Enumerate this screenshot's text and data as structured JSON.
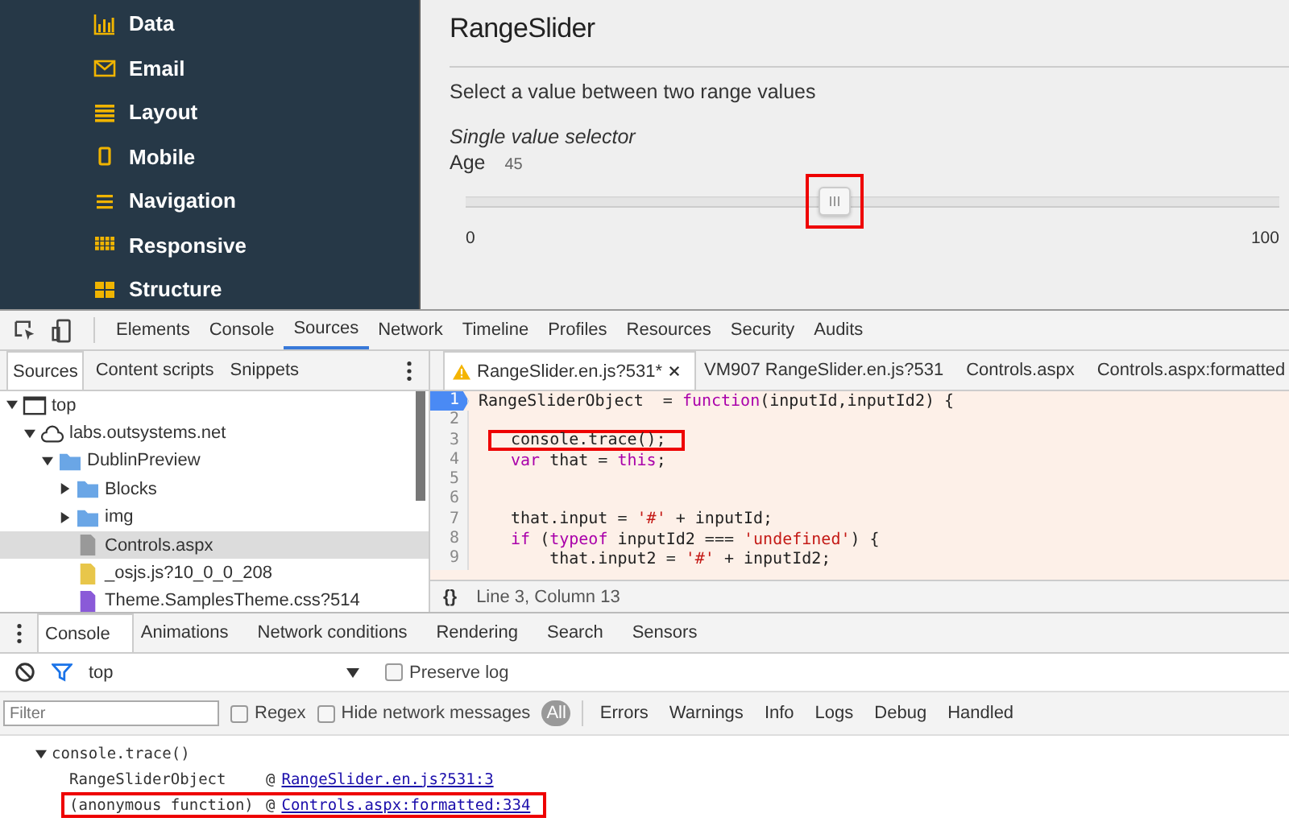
{
  "sidebar": {
    "items": [
      {
        "label": "Data",
        "kind": "chart"
      },
      {
        "label": "Email",
        "kind": "envelope"
      },
      {
        "label": "Layout",
        "kind": "lines"
      },
      {
        "label": "Mobile",
        "kind": "phone"
      },
      {
        "label": "Navigation",
        "kind": "menu"
      },
      {
        "label": "Responsive",
        "kind": "table"
      },
      {
        "label": "Structure",
        "kind": "blocks"
      }
    ]
  },
  "page": {
    "title": "RangeSlider",
    "description": "Select a value between two range values",
    "section": "Single value selector",
    "slider": {
      "label": "Age",
      "value": "45",
      "level": 0.45,
      "min": "0",
      "max": "100",
      "annotated": true
    }
  },
  "devtools": {
    "tabs": [
      {
        "label": "Elements",
        "selected": false
      },
      {
        "label": "Console",
        "selected": false
      },
      {
        "label": "Sources",
        "selected": true
      },
      {
        "label": "Network",
        "selected": false
      },
      {
        "label": "Timeline",
        "selected": false
      },
      {
        "label": "Profiles",
        "selected": false
      },
      {
        "label": "Resources",
        "selected": false
      },
      {
        "label": "Security",
        "selected": false
      },
      {
        "label": "Audits",
        "selected": false
      }
    ],
    "navigator": {
      "tabs": [
        {
          "label": "Sources",
          "selected": true
        },
        {
          "label": "Content scripts",
          "selected": false
        },
        {
          "label": "Snippets",
          "selected": false
        }
      ],
      "tree": [
        {
          "label": "top",
          "kind": "frame",
          "expanded": true,
          "selected": false,
          "children": [
            {
              "label": "labs.outsystems.net",
              "kind": "domain",
              "expanded": true,
              "selected": false,
              "children": [
                {
                  "label": "DublinPreview",
                  "kind": "folder",
                  "expanded": true,
                  "selected": false,
                  "children": [
                    {
                      "label": "Blocks",
                      "kind": "folder",
                      "expanded": false,
                      "selected": false
                    },
                    {
                      "label": "img",
                      "kind": "folder",
                      "expanded": false,
                      "selected": false
                    },
                    {
                      "label": "Controls.aspx",
                      "kind": "document",
                      "selected": true
                    },
                    {
                      "label": "_osjs.js?10_0_0_208",
                      "kind": "script",
                      "selected": false
                    },
                    {
                      "label": "Theme.SamplesTheme.css?514",
                      "kind": "stylesheet",
                      "selected": false
                    }
                  ]
                }
              ]
            }
          ]
        }
      ]
    },
    "editor": {
      "tabs": [
        {
          "label": "RangeSlider.en.js?531*",
          "warning": true,
          "selected": true
        },
        {
          "label": "VM907 RangeSlider.en.js?531",
          "warning": false,
          "selected": false
        },
        {
          "label": "Controls.aspx",
          "warning": false,
          "selected": false
        },
        {
          "label": "Controls.aspx:formatted",
          "warning": false,
          "selected": false
        }
      ],
      "lines": [
        {
          "number": "1",
          "current": true,
          "annotated": false,
          "segments": [
            {
              "kind": "plain",
              "text": "RangeSliderObject  = "
            },
            {
              "kind": "keyword",
              "text": "function"
            },
            {
              "kind": "plain",
              "text": "(inputId,inputId2) {"
            }
          ]
        },
        {
          "number": "2",
          "current": false
        },
        {
          "number": "3",
          "current": false,
          "annotated": true,
          "segments": [
            {
              "kind": "plain",
              "text": "console.trace();"
            }
          ]
        },
        {
          "number": "4",
          "current": false,
          "annotated": false,
          "segments": [
            {
              "kind": "keyword",
              "text": "var"
            },
            {
              "kind": "plain",
              "text": " that = "
            },
            {
              "kind": "keyword",
              "text": "this"
            },
            {
              "kind": "plain",
              "text": ";"
            }
          ]
        },
        {
          "number": "5",
          "current": false
        },
        {
          "number": "6",
          "current": false
        },
        {
          "number": "7",
          "current": false,
          "annotated": false,
          "segments": [
            {
              "kind": "plain",
              "text": "that.input = "
            },
            {
              "kind": "string",
              "text": "'#'"
            },
            {
              "kind": "plain",
              "text": " + inputId;"
            }
          ]
        },
        {
          "number": "8",
          "current": false,
          "annotated": false,
          "segments": [
            {
              "kind": "keyword",
              "text": "if"
            },
            {
              "kind": "plain",
              "text": " ("
            },
            {
              "kind": "keyword",
              "text": "typeof"
            },
            {
              "kind": "plain",
              "text": " inputId2 === "
            },
            {
              "kind": "string",
              "text": "'undefined'"
            },
            {
              "kind": "plain",
              "text": ") {"
            }
          ]
        },
        {
          "number": "9",
          "current": false,
          "annotated": false,
          "segments": [
            {
              "kind": "plain",
              "text": "    that.input2 = "
            },
            {
              "kind": "string",
              "text": "'#'"
            },
            {
              "kind": "plain",
              "text": " + inputId2;"
            }
          ]
        }
      ],
      "format_button": "{}",
      "status": "Line 3, Column 13"
    },
    "drawer": {
      "tabs": [
        {
          "label": "Console",
          "selected": true
        },
        {
          "label": "Animations",
          "selected": false
        },
        {
          "label": "Network conditions",
          "selected": false
        },
        {
          "label": "Rendering",
          "selected": false
        },
        {
          "label": "Search",
          "selected": false
        },
        {
          "label": "Sensors",
          "selected": false
        }
      ],
      "context": "top",
      "preserve_log": {
        "label": "Preserve log",
        "checked": false
      },
      "filter": {
        "placeholder": "Filter",
        "regex": {
          "label": "Regex",
          "checked": false
        },
        "hide_network": {
          "label": "Hide network messages",
          "checked": false
        },
        "levels": [
          {
            "label": "All",
            "selected": true
          },
          {
            "label": "Errors",
            "selected": false
          },
          {
            "label": "Warnings",
            "selected": false
          },
          {
            "label": "Info",
            "selected": false
          },
          {
            "label": "Logs",
            "selected": false
          },
          {
            "label": "Debug",
            "selected": false
          },
          {
            "label": "Handled",
            "selected": false
          }
        ]
      },
      "log": {
        "message": "console.trace()",
        "expanded": true,
        "frames": [
          {
            "function": "RangeSliderObject",
            "at": "@",
            "link": "RangeSlider.en.js?531:3",
            "annotated": false
          },
          {
            "function": "(anonymous function)",
            "at": "@",
            "link": "Controls.aspx:formatted:334",
            "annotated": true
          }
        ]
      }
    }
  }
}
